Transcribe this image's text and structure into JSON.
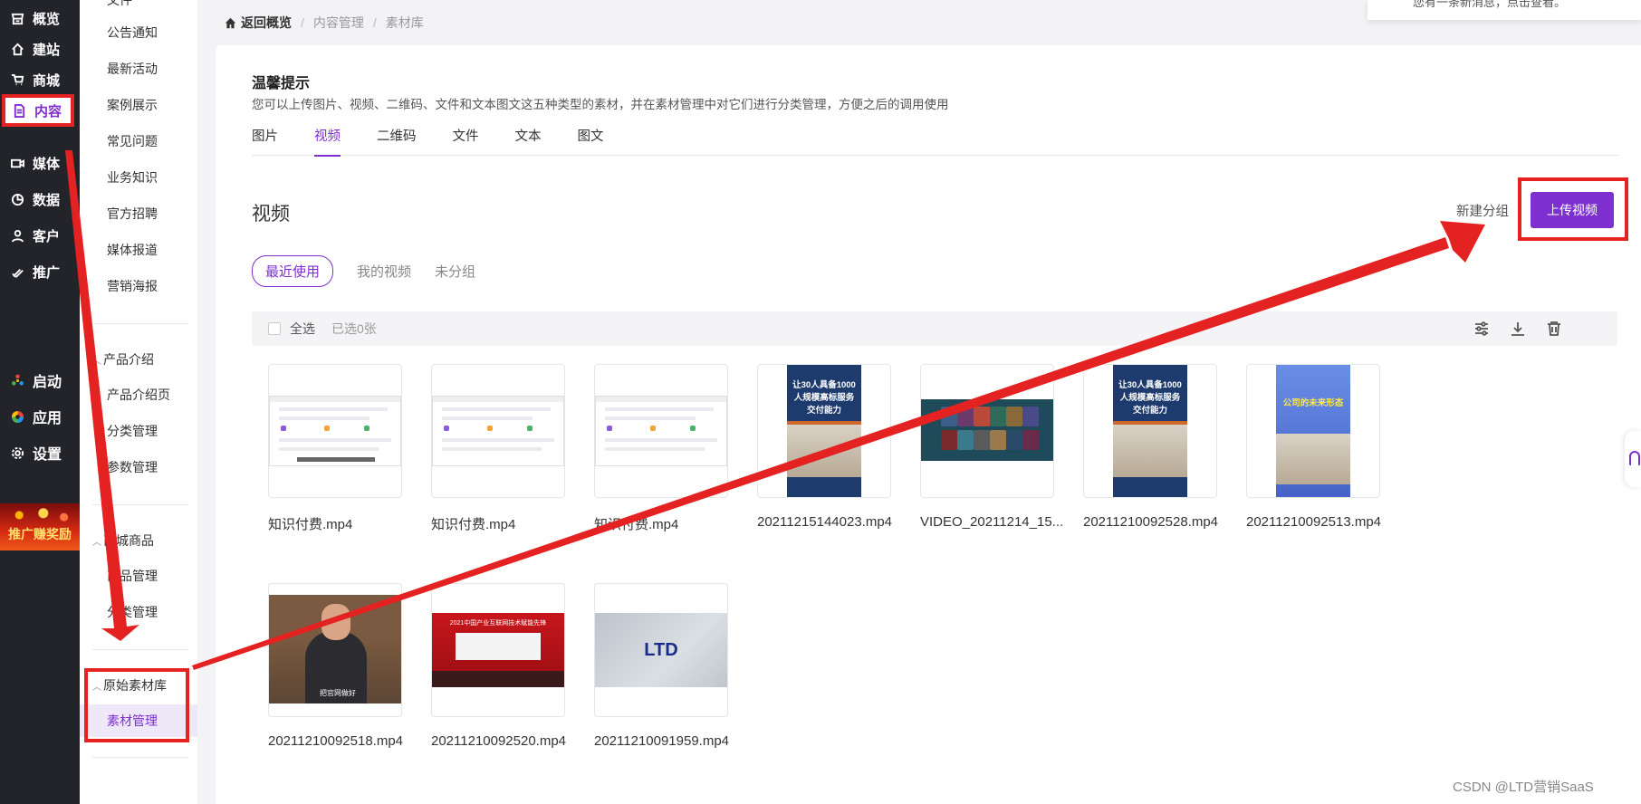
{
  "nav": {
    "items": [
      {
        "label": "概览",
        "icon": "store-icon"
      },
      {
        "label": "建站",
        "icon": "home-icon"
      },
      {
        "label": "商城",
        "icon": "cart-icon"
      },
      {
        "label": "内容",
        "icon": "document-icon"
      },
      {
        "label": "媒体",
        "icon": "camera-icon"
      },
      {
        "label": "数据",
        "icon": "pie-chart-icon"
      },
      {
        "label": "客户",
        "icon": "user-icon"
      },
      {
        "label": "推广",
        "icon": "tag-icon"
      }
    ],
    "apps": [
      {
        "label": "启动",
        "icon": "dots-icon"
      },
      {
        "label": "应用",
        "icon": "apps-icon"
      },
      {
        "label": "设置",
        "icon": "gear-icon"
      }
    ],
    "promo": "推广赚奖励"
  },
  "submenu": {
    "top_items": [
      "文件",
      "公告通知",
      "最新活动",
      "案例展示",
      "常见问题",
      "业务知识",
      "官方招聘",
      "媒体报道",
      "营销海报"
    ],
    "product_group": "产品介绍",
    "product_items": [
      "产品介绍页",
      "分类管理",
      "参数管理"
    ],
    "mall_group": "商城商品",
    "mall_items": [
      "商品管理",
      "分类管理"
    ],
    "material_group": "原始素材库",
    "material_items": [
      "素材管理"
    ]
  },
  "breadcrumb": {
    "home": "返回概览",
    "items": [
      "内容管理",
      "素材库"
    ]
  },
  "notice": "您有一条新消息，点击查看。",
  "tip": {
    "title": "温馨提示",
    "desc": "您可以上传图片、视频、二维码、文件和文本图文这五种类型的素材，并在素材管理中对它们进行分类管理，方便之后的调用使用"
  },
  "tabs": [
    "图片",
    "视频",
    "二维码",
    "文件",
    "文本",
    "图文"
  ],
  "active_tab": "视频",
  "section": {
    "title": "视频",
    "new_group": "新建分组",
    "upload": "上传视频"
  },
  "filters": [
    "最近使用",
    "我的视频",
    "未分组"
  ],
  "toolbar": {
    "select_all": "全选",
    "selected": "已选0张"
  },
  "videos": [
    {
      "name": "知识付费.mp4",
      "kind": "screen"
    },
    {
      "name": "知识付费.mp4",
      "kind": "screen"
    },
    {
      "name": "知识付费.mp4",
      "kind": "screen"
    },
    {
      "name": "20211215144023.mp4",
      "kind": "poster",
      "headline": "让30人具备1000人规模高标服务交付能力"
    },
    {
      "name": "VIDEO_20211214_15...",
      "kind": "game"
    },
    {
      "name": "20211210092528.mp4",
      "kind": "poster",
      "headline": "让30人具备1000人规模高标服务交付能力"
    },
    {
      "name": "20211210092513.mp4",
      "kind": "poster-blue",
      "headline": "公司的未来形态"
    },
    {
      "name": "20211210092518.mp4",
      "kind": "man",
      "subtitle": "把官网做好"
    },
    {
      "name": "20211210092520.mp4",
      "kind": "conference",
      "headline": "2021中国产业互联网技术赋能先锋"
    },
    {
      "name": "20211210091959.mp4",
      "kind": "ltd",
      "logo": "LTD"
    }
  ],
  "watermark": "CSDN @LTD营销SaaS",
  "colors": {
    "accent": "#7d2fd0",
    "annotation": "#e52222",
    "nav_bg": "#23242a"
  }
}
